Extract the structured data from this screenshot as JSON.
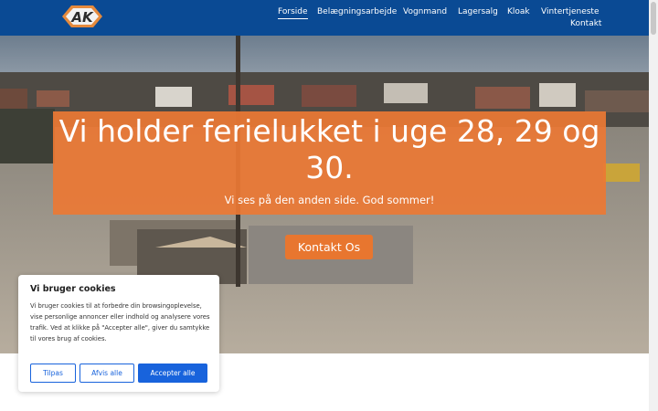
{
  "header": {
    "logo": {
      "text": "AK",
      "icon": "logo-icon"
    },
    "nav": [
      {
        "label": "Forside",
        "active": true
      },
      {
        "label": "Belægningsarbejde",
        "active": false
      },
      {
        "label": "Vognmand",
        "active": false
      },
      {
        "label": "Lagersalg",
        "active": false
      },
      {
        "label": "Kloak",
        "active": false
      },
      {
        "label": "Vintertjeneste",
        "active": false
      },
      {
        "label": "Kontakt",
        "active": false
      }
    ]
  },
  "hero": {
    "headline": "Vi holder ferielukket i uge 28, 29 og 30.",
    "subtext": "Vi ses på den anden side. God sommer!",
    "cta": "Kontakt Os"
  },
  "cookie": {
    "title": "Vi bruger cookies",
    "text": "Vi bruger cookies til at forbedre din browsingoplevelse, vise personlige annoncer eller indhold og analysere vores trafik. Ved at klikke på \"Accepter alle\", giver du samtykke til vores brug af cookies.",
    "buttons": {
      "customize": "Tilpas",
      "reject": "Afvis alle",
      "accept": "Accepter alle"
    }
  },
  "colors": {
    "nav_bg": "#0a4a94",
    "accent": "#e8762f",
    "cookie_button": "#1863dc"
  }
}
